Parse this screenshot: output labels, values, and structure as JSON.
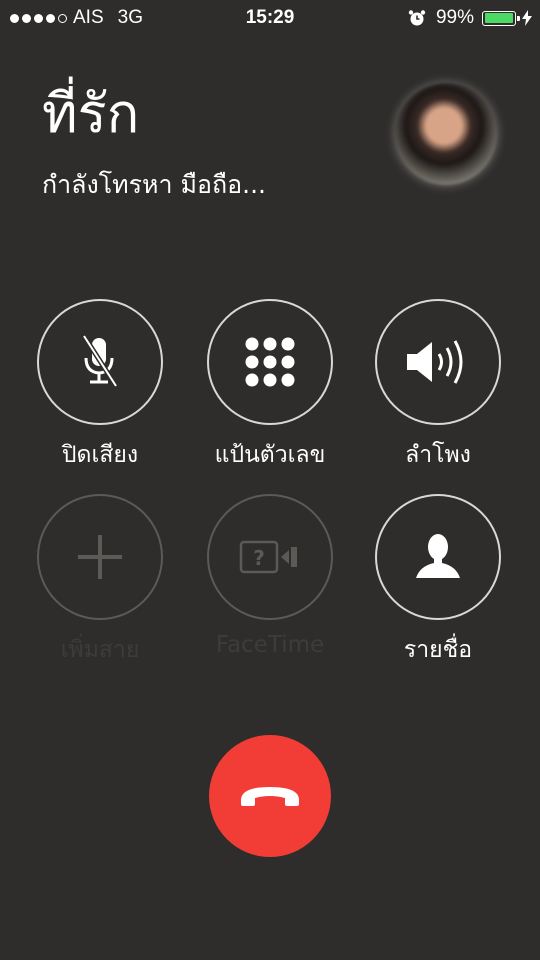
{
  "status_bar": {
    "carrier": "AIS",
    "network": "3G",
    "time": "15:29",
    "battery_percent": "99%",
    "battery_level": 0.99,
    "battery_color": "#4cd964",
    "icons": [
      "signal-dots-icon",
      "alarm-icon",
      "battery-icon",
      "charging-bolt-icon"
    ]
  },
  "call": {
    "contact_name": "ที่รัก",
    "status": "กำลังโทรหา มือถือ..."
  },
  "controls": {
    "mute": {
      "label": "ปิดเสียง",
      "icon": "microphone-muted-icon"
    },
    "keypad": {
      "label": "แป้นตัวเลข",
      "icon": "keypad-icon"
    },
    "speaker": {
      "label": "ลำโพง",
      "icon": "speaker-icon"
    },
    "add_call": {
      "label": "เพิ่มสาย",
      "icon": "plus-icon",
      "enabled": false
    },
    "facetime": {
      "label": "FaceTime",
      "icon": "facetime-icon",
      "enabled": false
    },
    "contacts": {
      "label": "รายชื่อ",
      "icon": "contact-person-icon"
    }
  },
  "end_call": {
    "icon": "hang-up-phone-icon",
    "color": "#f23d36"
  }
}
